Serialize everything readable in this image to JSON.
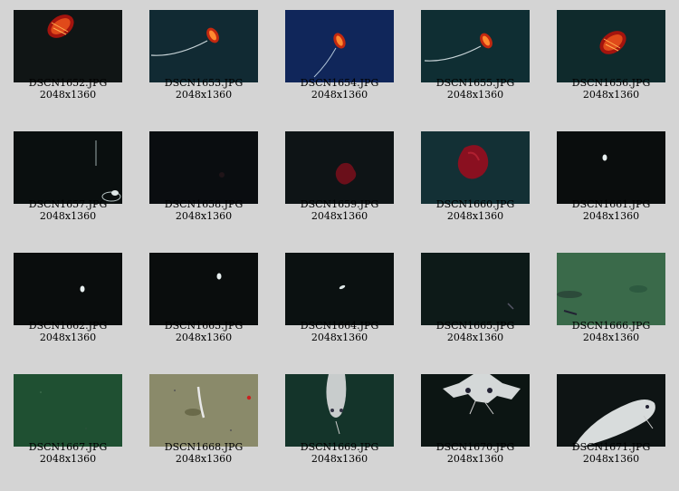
{
  "gallery": {
    "items": [
      {
        "filename": "DSCN1652.JPG",
        "dimensions": "2048x1360",
        "scene": "ctenophore-red",
        "bg": "#101515"
      },
      {
        "filename": "DSCN1653.JPG",
        "dimensions": "2048x1360",
        "scene": "ctenophore-tentacle",
        "bg": "#112a33"
      },
      {
        "filename": "DSCN1654.JPG",
        "dimensions": "2048x1360",
        "scene": "ctenophore-blue",
        "bg": "#10265a"
      },
      {
        "filename": "DSCN1655.JPG",
        "dimensions": "2048x1360",
        "scene": "ctenophore-tentacle",
        "bg": "#0f2e33"
      },
      {
        "filename": "DSCN1656.JPG",
        "dimensions": "2048x1360",
        "scene": "ctenophore-red",
        "bg": "#0f2a2c"
      },
      {
        "filename": "DSCN1657.JPG",
        "dimensions": "2048x1360",
        "scene": "dark-debris",
        "bg": "#0a0f0f"
      },
      {
        "filename": "DSCN1658.JPG",
        "dimensions": "2048x1360",
        "scene": "dark-empty",
        "bg": "#0a0d10"
      },
      {
        "filename": "DSCN1659.JPG",
        "dimensions": "2048x1360",
        "scene": "red-jelly-small",
        "bg": "#0e1416"
      },
      {
        "filename": "DSCN1660.JPG",
        "dimensions": "2048x1360",
        "scene": "red-jelly-large",
        "bg": "#133035"
      },
      {
        "filename": "DSCN1661.JPG",
        "dimensions": "2048x1360",
        "scene": "speck",
        "bg": "#0a0d0d"
      },
      {
        "filename": "DSCN1662.JPG",
        "dimensions": "2048x1360",
        "scene": "speck",
        "bg": "#0a0d0d"
      },
      {
        "filename": "DSCN1663.JPG",
        "dimensions": "2048x1360",
        "scene": "speck",
        "bg": "#0a0d0d"
      },
      {
        "filename": "DSCN1664.JPG",
        "dimensions": "2048x1360",
        "scene": "speck-right",
        "bg": "#0b1111"
      },
      {
        "filename": "DSCN1665.JPG",
        "dimensions": "2048x1360",
        "scene": "dark-faint",
        "bg": "#0d1a18"
      },
      {
        "filename": "DSCN1666.JPG",
        "dimensions": "2048x1360",
        "scene": "seafloor-green",
        "bg": "#3a6a4a"
      },
      {
        "filename": "DSCN1667.JPG",
        "dimensions": "2048x1360",
        "scene": "seafloor-dark-green",
        "bg": "#1f5032"
      },
      {
        "filename": "DSCN1668.JPG",
        "dimensions": "2048x1360",
        "scene": "seafloor-sand",
        "bg": "#8a8a6a"
      },
      {
        "filename": "DSCN1669.JPG",
        "dimensions": "2048x1360",
        "scene": "fish-front",
        "bg": "#14342a"
      },
      {
        "filename": "DSCN1670.JPG",
        "dimensions": "2048x1360",
        "scene": "fish-top",
        "bg": "#0c1513"
      },
      {
        "filename": "DSCN1671.JPG",
        "dimensions": "2048x1360",
        "scene": "fish-side",
        "bg": "#0e1414"
      }
    ]
  }
}
